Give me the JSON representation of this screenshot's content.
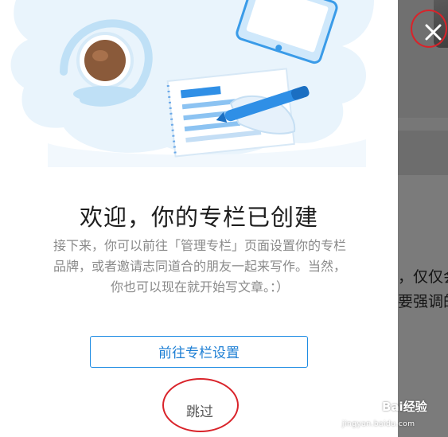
{
  "background": {
    "partial_lines": [
      "，仅仅会",
      "要强调的"
    ]
  },
  "dialog": {
    "title": "欢迎，你的专栏已创建",
    "description_lines": [
      "接下来，你可以前往「管理专栏」页面设置你的专栏",
      "品牌，或者邀请志同道合的朋友一起来写作。当然，",
      "你也可以现在就开始写文章。：）"
    ],
    "primary_button_label": "前往专栏设置",
    "skip_label": "跳过"
  },
  "close": {
    "icon": "close-icon"
  },
  "watermark": {
    "text": "Bai经验",
    "url": "jingyan.baidu.com"
  },
  "colors": {
    "accent": "#1e8ce3",
    "annotation_red": "#d9232a",
    "title": "#1d1d1d",
    "description": "#8a8a8a"
  }
}
